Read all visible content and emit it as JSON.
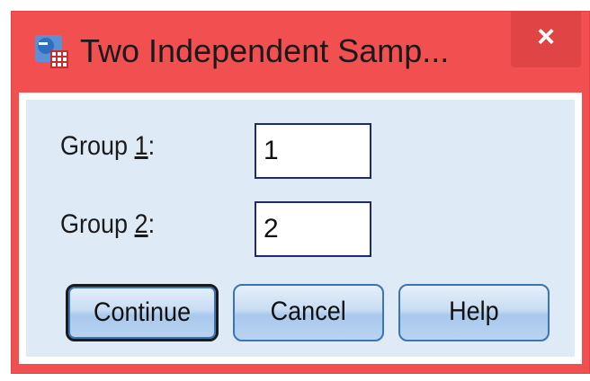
{
  "window": {
    "title": "Two Independent Samp...",
    "close_glyph": "×",
    "app_icon": "spss-dialog-icon"
  },
  "fields": [
    {
      "label_prefix": "Group ",
      "label_mnemonic": "1",
      "label_suffix": ":",
      "value": "1"
    },
    {
      "label_prefix": "Group ",
      "label_mnemonic": "2",
      "label_suffix": ":",
      "value": "2"
    }
  ],
  "buttons": {
    "continue": "Continue",
    "cancel": "Cancel",
    "help": "Help"
  },
  "colors": {
    "frame": "#f25050",
    "panel": "#deebf7",
    "button_border": "#3b73b3",
    "field_border": "#1e2a6e"
  }
}
